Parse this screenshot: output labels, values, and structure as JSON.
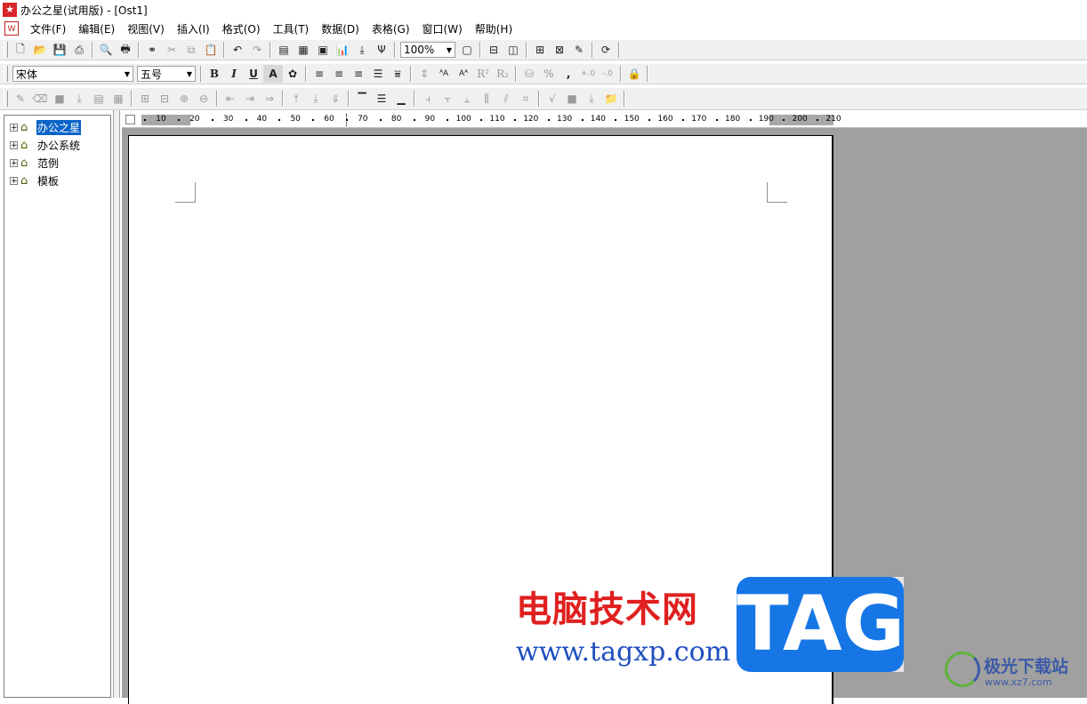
{
  "window": {
    "title": "办公之星(试用版) - [Ost1]",
    "app_icon": "app-star-icon"
  },
  "menu": [
    "文件(F)",
    "编辑(E)",
    "视图(V)",
    "插入(I)",
    "格式(O)",
    "工具(T)",
    "数据(D)",
    "表格(G)",
    "窗口(W)",
    "帮助(H)"
  ],
  "toolbar1": {
    "zoom_value": "100%",
    "icons": [
      "new-doc-icon",
      "open-folder-icon",
      "save-icon",
      "print-setup-icon",
      "print-preview-icon",
      "print-icon",
      "find-binoculars-icon",
      "cut-icon",
      "copy-icon",
      "paste-icon",
      "undo-icon",
      "redo-icon",
      "insert-text-icon",
      "insert-table-icon",
      "insert-picture-icon",
      "insert-chart-icon",
      "insert-down-icon",
      "insert-symbol-icon",
      "full-page-icon",
      "split-horizontal-icon",
      "split-vertical-icon",
      "page-view-icon",
      "edit-frame-icon",
      "draw-icon",
      "refresh-icon"
    ]
  },
  "toolbar2": {
    "font_name": "宋体",
    "font_size": "五号",
    "bold_label": "B",
    "italic_label": "I",
    "underline_label": "U",
    "outline_label": "A",
    "superscript_label": "R²",
    "subscript_label": "R₂",
    "percent_label": "%",
    "comma_label": ","
  },
  "tree": {
    "items": [
      {
        "label": "办公之星",
        "selected": true
      },
      {
        "label": "办公系统",
        "selected": false
      },
      {
        "label": "范例",
        "selected": false
      },
      {
        "label": "模板",
        "selected": false
      }
    ]
  },
  "ruler": {
    "ticks": [
      "10",
      "20",
      "30",
      "40",
      "50",
      "60",
      "70",
      "80",
      "90",
      "100",
      "110",
      "120",
      "130",
      "140",
      "150",
      "160",
      "170",
      "180",
      "190",
      "200",
      "210"
    ]
  },
  "watermark": {
    "site_cn": "电脑技术网",
    "site_url": "www.tagxp.com",
    "tag_text": "TAG",
    "xz7_name": "极光下载站",
    "xz7_url": "www.xz7.com"
  },
  "colors": {
    "selection": "#0a64c8",
    "workspace": "#a0a0a0",
    "app_icon": "#d8262b",
    "watermark_red": "#e02020",
    "watermark_blue": "#1676e6"
  }
}
